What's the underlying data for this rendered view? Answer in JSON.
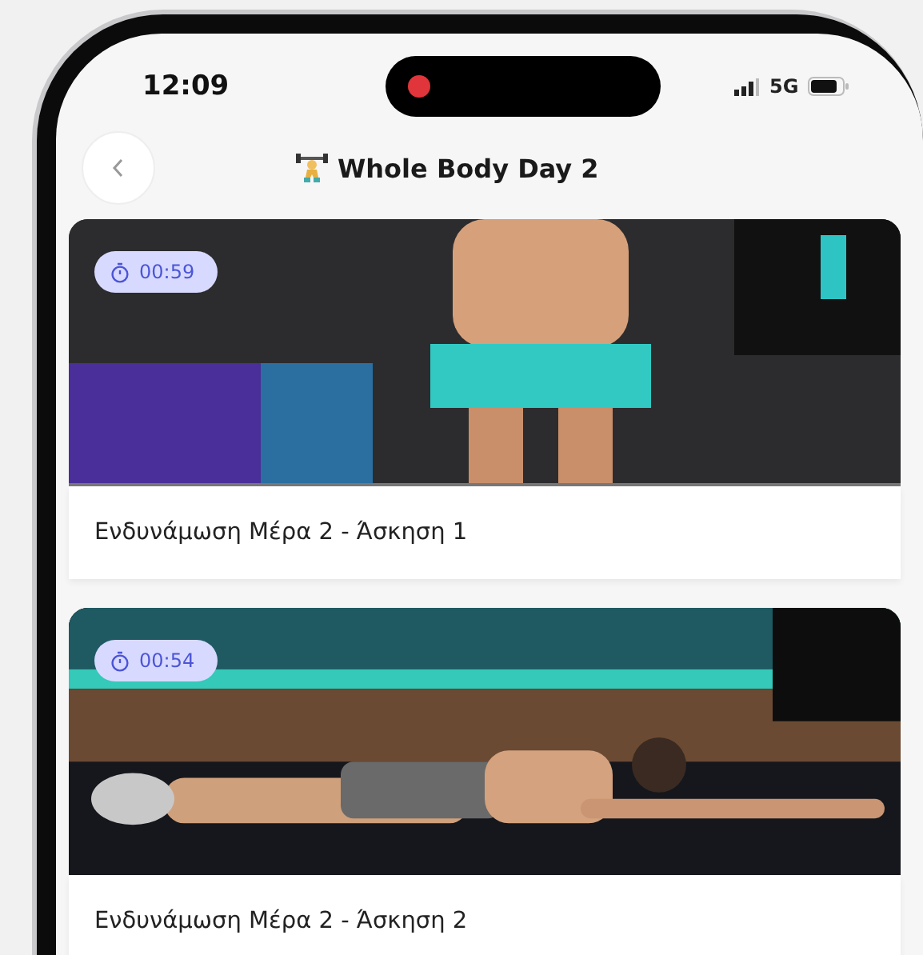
{
  "status_bar": {
    "time": "12:09",
    "network": "5G"
  },
  "header": {
    "title": "Whole Body Day 2"
  },
  "exercises": [
    {
      "duration": "00:59",
      "title": "Ενδυνάμωση Μέρα 2 - Άσκηση 1"
    },
    {
      "duration": "00:54",
      "title": "Ενδυνάμωση Μέρα 2 - Άσκηση 2"
    }
  ]
}
